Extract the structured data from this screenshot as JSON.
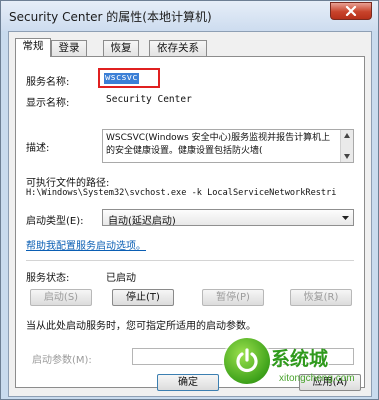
{
  "window": {
    "title": "Security Center 的属性(本地计算机)"
  },
  "tabs": [
    {
      "label": "常规"
    },
    {
      "label": "登录"
    },
    {
      "label": "恢复"
    },
    {
      "label": "依存关系"
    }
  ],
  "general": {
    "service_name_label": "服务名称:",
    "service_name_value": "wscsvc",
    "display_name_label": "显示名称:",
    "display_name_value": "Security Center",
    "description_label": "描述:",
    "description_value": "WSCSVC(Windows 安全中心)服务监视并报告计算机上的安全健康设置。健康设置包括防火墙(",
    "exe_path_label": "可执行文件的路径:",
    "exe_path_value": "H:\\Windows\\System32\\svchost.exe -k LocalServiceNetworkRestri",
    "startup_type_label": "启动类型(E):",
    "startup_type_value": "自动(延迟启动)",
    "help_link": "帮助我配置服务启动选项。",
    "status_label": "服务状态:",
    "status_value": "已启动",
    "buttons": {
      "start": "启动(S)",
      "stop": "停止(T)",
      "pause": "暂停(P)",
      "resume": "恢复(R)"
    },
    "hint_text": "当从此处启动服务时，您可指定所适用的启动参数。",
    "start_params_label": "启动参数(M):",
    "start_params_value": ""
  },
  "footer": {
    "ok": "确定",
    "apply": "应用(A)"
  },
  "watermark": {
    "brand": "系统城",
    "url": "xitongcheng.com"
  },
  "colors": {
    "highlight_box": "#e02020",
    "selection": "#3b7fd6",
    "link": "#0b5fb4",
    "watermark_green": "#2f9a1c"
  }
}
